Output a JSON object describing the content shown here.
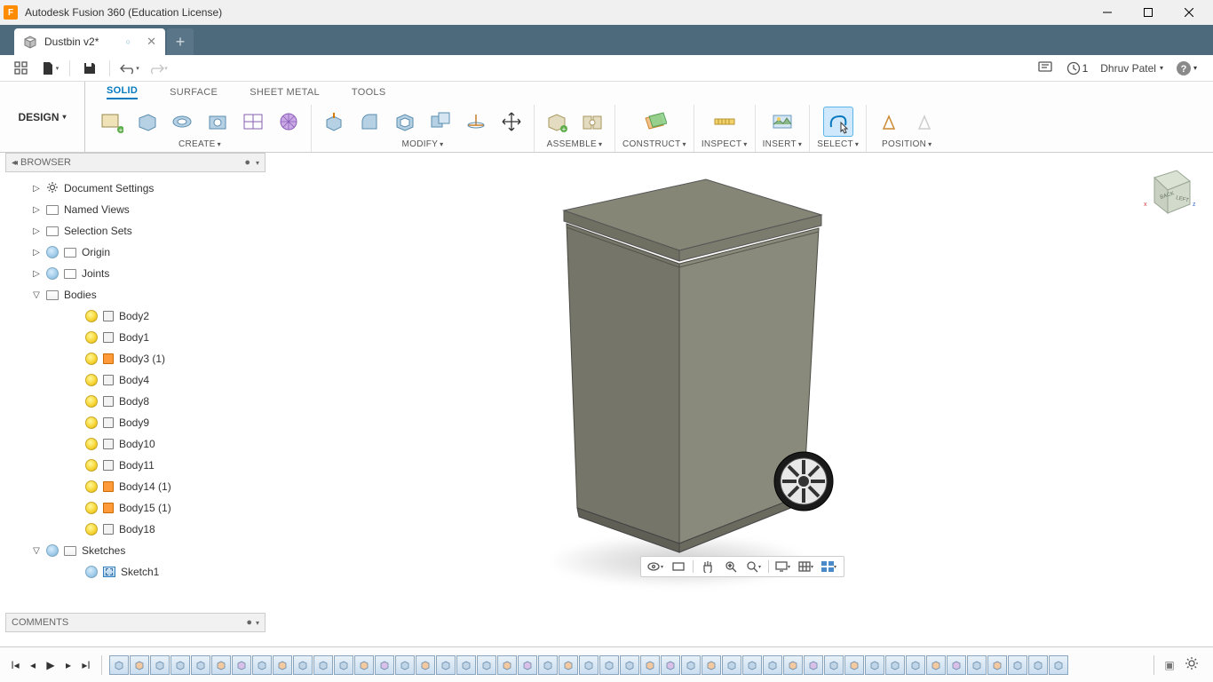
{
  "window": {
    "title": "Autodesk Fusion 360 (Education License)"
  },
  "tab": {
    "name": "Dustbin v2*",
    "unsaved_indicator": "○"
  },
  "qat": {
    "jobs": "1",
    "user": "Dhruv Patel"
  },
  "workspace": "DESIGN",
  "ribbon_tabs": [
    "SOLID",
    "SURFACE",
    "SHEET METAL",
    "TOOLS"
  ],
  "ribbon_tabs_active": 0,
  "tool_groups": [
    "CREATE",
    "MODIFY",
    "ASSEMBLE",
    "CONSTRUCT",
    "INSPECT",
    "INSERT",
    "SELECT",
    "POSITION"
  ],
  "browser_header": "BROWSER",
  "tree": [
    {
      "lvl": 1,
      "arrow": "▷",
      "icons": [
        "gear"
      ],
      "label": "Document Settings"
    },
    {
      "lvl": 1,
      "arrow": "▷",
      "icons": [
        "folder"
      ],
      "label": "Named Views"
    },
    {
      "lvl": 1,
      "arrow": "▷",
      "icons": [
        "folder"
      ],
      "label": "Selection Sets"
    },
    {
      "lvl": 1,
      "arrow": "▷",
      "icons": [
        "bulb-dim",
        "folder"
      ],
      "label": "Origin"
    },
    {
      "lvl": 1,
      "arrow": "▷",
      "icons": [
        "bulb-dim",
        "folder"
      ],
      "label": "Joints"
    },
    {
      "lvl": 1,
      "arrow": "▽",
      "icons": [
        "folder-exp"
      ],
      "label": "Bodies"
    },
    {
      "lvl": 3,
      "icons": [
        "bulb",
        "body"
      ],
      "label": "Body2"
    },
    {
      "lvl": 3,
      "icons": [
        "bulb",
        "body"
      ],
      "label": "Body1"
    },
    {
      "lvl": 3,
      "icons": [
        "bulb",
        "body-orange"
      ],
      "label": "Body3 (1)"
    },
    {
      "lvl": 3,
      "icons": [
        "bulb",
        "body"
      ],
      "label": "Body4"
    },
    {
      "lvl": 3,
      "icons": [
        "bulb",
        "body"
      ],
      "label": "Body8"
    },
    {
      "lvl": 3,
      "icons": [
        "bulb",
        "body"
      ],
      "label": "Body9"
    },
    {
      "lvl": 3,
      "icons": [
        "bulb",
        "body"
      ],
      "label": "Body10"
    },
    {
      "lvl": 3,
      "icons": [
        "bulb",
        "body"
      ],
      "label": "Body11"
    },
    {
      "lvl": 3,
      "icons": [
        "bulb",
        "body-orange"
      ],
      "label": "Body14 (1)"
    },
    {
      "lvl": 3,
      "icons": [
        "bulb",
        "body-orange"
      ],
      "label": "Body15 (1)"
    },
    {
      "lvl": 3,
      "icons": [
        "bulb",
        "body"
      ],
      "label": "Body18"
    },
    {
      "lvl": 1,
      "arrow": "▽",
      "icons": [
        "bulb-dim",
        "folder-exp"
      ],
      "label": "Sketches"
    },
    {
      "lvl": 3,
      "icons": [
        "bulb-dim",
        "sketch"
      ],
      "label": "Sketch1"
    }
  ],
  "comments_header": "COMMENTS",
  "viewcube": {
    "faces": [
      "BACK",
      "LEFT"
    ],
    "axes": [
      "x",
      "z"
    ]
  },
  "timeline_count": 47
}
